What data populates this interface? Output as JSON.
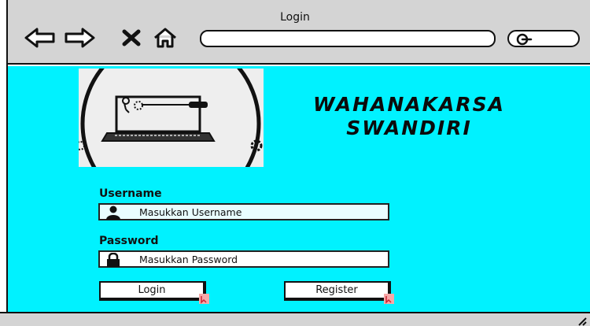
{
  "window": {
    "title": "Login",
    "nav_icons": [
      "back-arrow-icon",
      "forward-arrow-icon",
      "close-x-icon",
      "home-icon"
    ],
    "url_value": "",
    "search_icon": "search-magnifier-icon"
  },
  "colors": {
    "content_background": "#00f2ff",
    "chrome": "#d4d4d4",
    "username_field_background": "#e9fdff"
  },
  "logo": {
    "image": "laptop-with-tools-and-gears-logo"
  },
  "brand": {
    "line1": "WAHANAKARSA",
    "line2": "SWANDIRI"
  },
  "form": {
    "username_label": "Username",
    "username_placeholder": "Masukkan Username",
    "username_icon": "user-icon",
    "password_label": "Password",
    "password_placeholder": "Masukkan Password",
    "password_icon": "lock-icon",
    "login_label": "Login",
    "register_label": "Register"
  }
}
